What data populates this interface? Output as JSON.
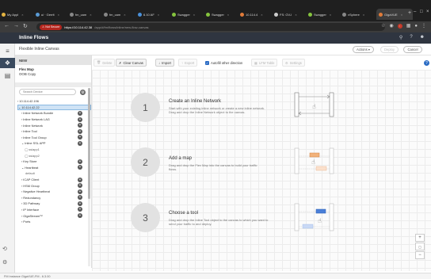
{
  "browser": {
    "tabs": [
      {
        "label": "My Appl",
        "color": "#e3b341"
      },
      {
        "label": "ui · Gerrit",
        "color": "#5a9bd5"
      },
      {
        "label": "fm_cam",
        "color": "#888888"
      },
      {
        "label": "fm_cam",
        "color": "#888888"
      },
      {
        "label": "6.10 AF",
        "color": "#4a90d9"
      },
      {
        "label": "Swagger",
        "color": "#85c43e"
      },
      {
        "label": "Swagger",
        "color": "#85c43e"
      },
      {
        "label": "10.114.4",
        "color": "#e07b39"
      },
      {
        "label": "FS: GV-I",
        "color": "#cccccc"
      },
      {
        "label": "Swagger",
        "color": "#85c43e"
      },
      {
        "label": "vSphere",
        "color": "#888888"
      },
      {
        "label": "GigaVUE",
        "color": "#e07b39",
        "active": true
      }
    ],
    "not_secure": "Not Secure",
    "url_host": "https://10.114.42.38",
    "url_path": "/app/#/fm/flows/inline/new-flow-canvas"
  },
  "app": {
    "title": "Inline Flows",
    "page_title": "Flexible Inline Canvas",
    "actions_label": "Actions",
    "deploy_label": "Deploy",
    "cancel_label": "Cancel"
  },
  "panel": {
    "header": "NEW",
    "flows": [
      "Flex Map",
      "OOB Copy"
    ],
    "search_placeholder": "Search Device",
    "tree": [
      {
        "label": "10.114.42.196",
        "level": "ip",
        "prefix": "› "
      },
      {
        "label": "10.114.42.22",
        "level": "ip",
        "prefix": "⌄ ",
        "selected": true
      },
      {
        "label": "Inline Network Bundle",
        "level": "port",
        "prefix": "› ",
        "add": true
      },
      {
        "label": "Inline Network LAG",
        "level": "port",
        "prefix": "› ",
        "add": true
      },
      {
        "label": "Inline Network",
        "level": "port",
        "prefix": "› ",
        "add": true
      },
      {
        "label": "Inline Tool",
        "level": "port",
        "prefix": "› ",
        "add": true
      },
      {
        "label": "Inline Tool Group",
        "level": "port",
        "prefix": "› ",
        "add": true
      },
      {
        "label": "Inline SSL APP",
        "level": "port",
        "prefix": "⌄ ",
        "add": true
      },
      {
        "label": "ssiapp1",
        "level": "sub",
        "prefix": "◯ "
      },
      {
        "label": "ssiapp2",
        "level": "sub",
        "prefix": "◯ "
      },
      {
        "label": "Key Store",
        "level": "port",
        "prefix": "› ",
        "add": true
      },
      {
        "label": "Heartbeat",
        "level": "port",
        "prefix": "⌄ ",
        "add": true
      },
      {
        "label": "default",
        "level": "sub",
        "prefix": ""
      },
      {
        "label": "ICAP Client",
        "level": "port",
        "prefix": "› ",
        "add": true
      },
      {
        "label": "HSM Group",
        "level": "port",
        "prefix": "› ",
        "add": true
      },
      {
        "label": "Negative Heartbeat",
        "level": "port",
        "prefix": "› ",
        "add": true
      },
      {
        "label": "Redundancy",
        "level": "port",
        "prefix": "› ",
        "add": true
      },
      {
        "label": "3D Pathway",
        "level": "port",
        "prefix": "› ",
        "add": true
      },
      {
        "label": "IP Interface",
        "level": "port",
        "prefix": "› ",
        "add": true
      },
      {
        "label": "GigaStream™",
        "level": "port",
        "prefix": "› ",
        "add": true
      },
      {
        "label": "Ports",
        "level": "port",
        "prefix": "› "
      }
    ]
  },
  "toolbar": {
    "delete": "Delete",
    "clear": "Clear Canvas",
    "import": "Import",
    "export": "Export",
    "autofill": "Autofill other direction",
    "lfm_table": "LFM Table",
    "settings": "Settings"
  },
  "steps": [
    {
      "number": "1",
      "title": "Create an Inline Network",
      "desc": "Start with your existing inline network or create a new inline network. Drag and drop the Inline Network object to the canvas."
    },
    {
      "number": "2",
      "title": "Add a map",
      "desc": "Drag and drop the Flex Map into the canvas to build your traffic flows."
    },
    {
      "number": "3",
      "title": "Choose a tool",
      "desc": "Drag and drop the Inline Tool object to the canvas to which you want to send your traffic to and deploy."
    }
  ],
  "zoom": {
    "in": "+",
    "reset": "▢",
    "out": "−"
  },
  "status": {
    "text": "FM Instance GigaVUE-FM - 6.3.00"
  },
  "colors": {
    "header": "#2f3540",
    "accent": "#2b6cc4",
    "map_orange": "#f2b27a",
    "tool_blue": "#4a7fd8"
  }
}
